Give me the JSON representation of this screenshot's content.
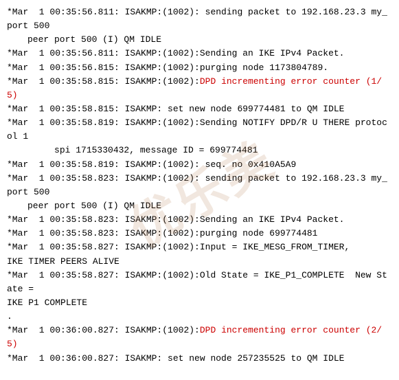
{
  "watermark": "优乐美",
  "lines": [
    {
      "id": 1,
      "text": "*Mar  1 00:35:56.811: ISAKMP:(1002): sending packet to 192.168.23.3 my_port 500",
      "class": "",
      "highlight": null
    },
    {
      "id": 2,
      "text": "peer port 500 (I) QM IDLE",
      "class": "indent",
      "highlight": null
    },
    {
      "id": 3,
      "text": "*Mar  1 00:35:56.811: ISAKMP:(1002):Sending an IKE IPv4 Packet.",
      "class": "",
      "highlight": null
    },
    {
      "id": 4,
      "text": "*Mar  1 00:35:56.815: ISAKMP:(1002):purging node 1173804789.",
      "class": "",
      "highlight": null
    },
    {
      "id": 5,
      "text": "*Mar  1 00:35:58.815: ISAKMP:(1002):",
      "class": "",
      "highlight": "DPD incrementing error counter (1/5)",
      "highlight_class": "highlight-red"
    },
    {
      "id": 6,
      "text": "*Mar  1 00:35:58.815: ISAKMP: set new node 699774481 to QM IDLE",
      "class": "",
      "highlight": null
    },
    {
      "id": 7,
      "text": "*Mar  1 00:35:58.819: ISAKMP:(1002):Sending NOTIFY DPD/R U THERE protocol 1",
      "class": "",
      "highlight": null
    },
    {
      "id": 8,
      "text": "     spi 1715330432, message ID = 699774481",
      "class": "indent",
      "highlight": null
    },
    {
      "id": 9,
      "text": "*Mar  1 00:35:58.819: ISAKMP:(1002): seq. no 0x410A5A9",
      "class": "",
      "highlight": null
    },
    {
      "id": 10,
      "text": "*Mar  1 00:35:58.823: ISAKMP:(1002): sending packet to 192.168.23.3 my_port 500",
      "class": "",
      "highlight": null
    },
    {
      "id": 11,
      "text": "peer port 500 (I) QM IDLE",
      "class": "indent",
      "highlight": null
    },
    {
      "id": 12,
      "text": "*Mar  1 00:35:58.823: ISAKMP:(1002):Sending an IKE IPv4 Packet.",
      "class": "",
      "highlight": null
    },
    {
      "id": 13,
      "text": "*Mar  1 00:35:58.823: ISAKMP:(1002):purging node 699774481",
      "class": "",
      "highlight": null
    },
    {
      "id": 14,
      "text": "*Mar  1 00:35:58.827: ISAKMP:(1002):Input = IKE_MESG_FROM_TIMER,",
      "class": "",
      "highlight": null
    },
    {
      "id": 15,
      "text": "IKE TIMER PEERS ALIVE",
      "class": "",
      "highlight": null
    },
    {
      "id": 16,
      "text": "*Mar  1 00:35:58.827: ISAKMP:(1002):Old State = IKE_P1_COMPLETE  New State =",
      "class": "",
      "highlight": null
    },
    {
      "id": 17,
      "text": "IKE P1 COMPLETE",
      "class": "",
      "highlight": null
    },
    {
      "id": 18,
      "text": ".",
      "class": "",
      "highlight": null
    },
    {
      "id": 19,
      "text": "*Mar  1 00:36:00.827: ISAKMP:(1002):",
      "class": "",
      "highlight": "DPD incrementing error counter (2/5)",
      "highlight_class": "highlight-red"
    },
    {
      "id": 20,
      "text": "*Mar  1 00:36:00.827: ISAKMP: set new node 257235525 to QM IDLE",
      "class": "",
      "highlight": null
    }
  ]
}
